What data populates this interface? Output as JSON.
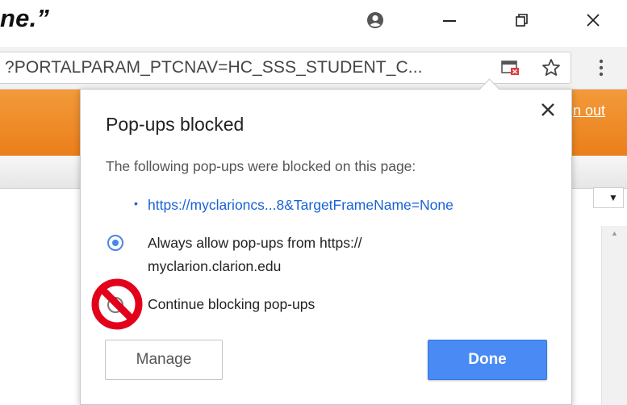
{
  "caption": {
    "text": "ne.”"
  },
  "window_controls": {
    "profile_icon": "account-circle-icon",
    "minimize_icon": "minimize-icon",
    "restore_icon": "restore-icon",
    "close_icon": "close-icon"
  },
  "toolbar": {
    "url": "?PORTALPARAM_PTCNAV=HC_SSS_STUDENT_C...",
    "popup_blocked_icon": "popup-blocked-icon",
    "bookmark_icon": "star-icon",
    "menu_icon": "kebab-menu-icon"
  },
  "page": {
    "sign_out_label": "n out",
    "accent_color": "#ef8a25"
  },
  "popup": {
    "title": "Pop-ups blocked",
    "description": "The following pop-ups were blocked on this page:",
    "blocked_link": "https://myclarioncs...8&TargetFrameName=None",
    "options": [
      {
        "label_line1": "Always allow pop-ups from https://",
        "label_line2": "myclarion.clarion.edu",
        "selected": true
      },
      {
        "label": "Continue blocking pop-ups",
        "selected": false
      }
    ],
    "manage_label": "Manage",
    "done_label": "Done",
    "prohibition_icon": "prohibited-sign-icon",
    "accent_color": "#4a8af4"
  }
}
